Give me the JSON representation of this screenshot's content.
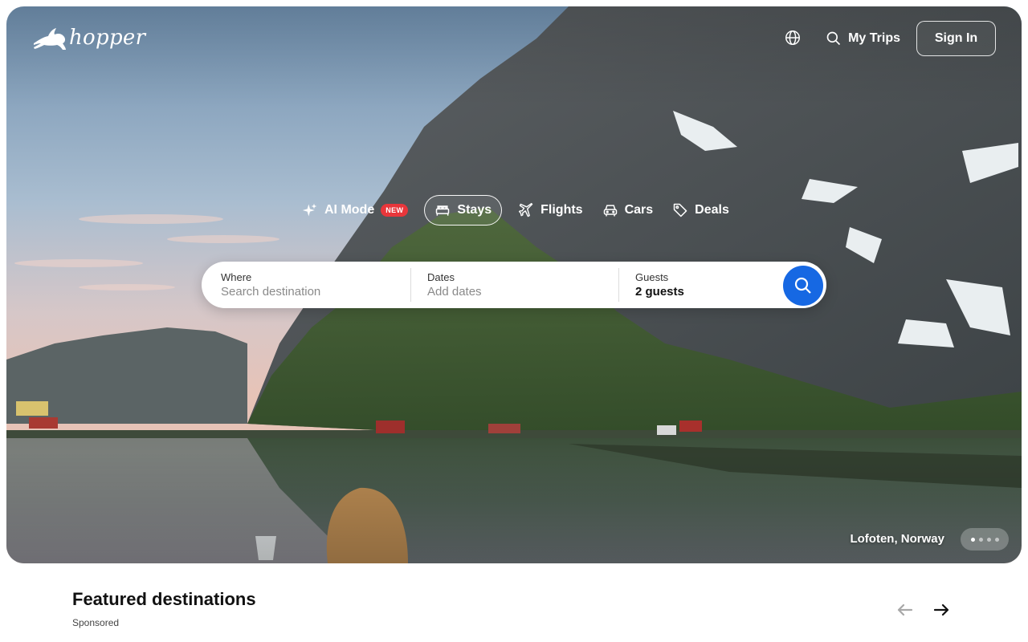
{
  "brand": {
    "name": "hopper"
  },
  "nav": {
    "language_icon": "globe-icon",
    "my_trips": "My Trips",
    "sign_in": "Sign In"
  },
  "tabs": [
    {
      "label": "AI Mode",
      "icon": "sparkle-icon",
      "badge": "NEW",
      "active": false
    },
    {
      "label": "Stays",
      "icon": "bed-icon",
      "active": true
    },
    {
      "label": "Flights",
      "icon": "airplane-icon",
      "active": false
    },
    {
      "label": "Cars",
      "icon": "car-icon",
      "active": false
    },
    {
      "label": "Deals",
      "icon": "tag-icon",
      "active": false
    }
  ],
  "search": {
    "where_label": "Where",
    "where_placeholder": "Search destination",
    "dates_label": "Dates",
    "dates_placeholder": "Add dates",
    "guests_label": "Guests",
    "guests_value": "2 guests"
  },
  "hero": {
    "caption": "Lofoten, Norway",
    "slides_total": 4,
    "slide_active": 1
  },
  "featured": {
    "title": "Featured destinations",
    "sponsored": "Sponsored"
  },
  "colors": {
    "accent": "#1668e3",
    "badge": "#e8363b"
  }
}
